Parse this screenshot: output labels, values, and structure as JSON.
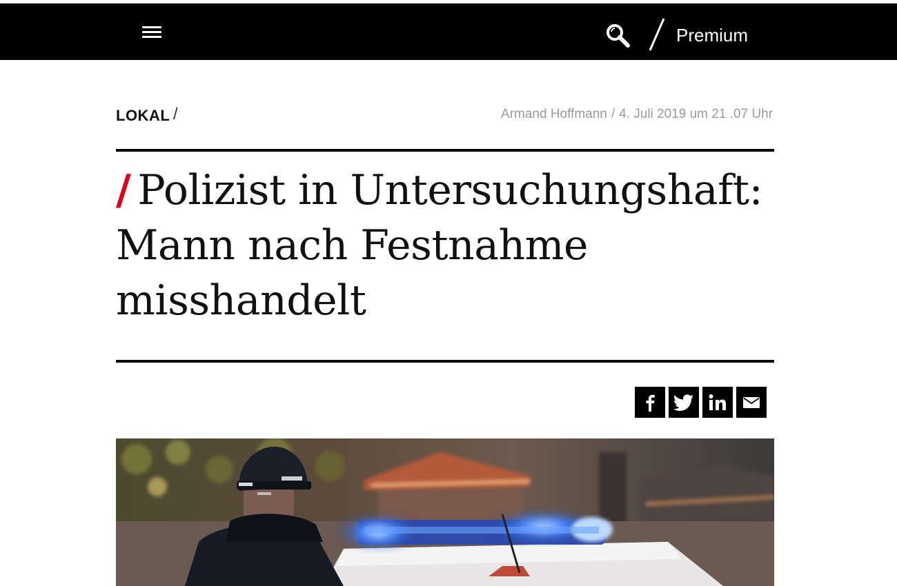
{
  "header": {
    "menu_icon": "hamburger-menu-icon",
    "search_icon": "search-icon",
    "premium_label": "Premium"
  },
  "article": {
    "section": "LOKAL",
    "section_separator": "/",
    "author": "Armand Hoffmann",
    "byline_separator": "/",
    "date": "4. Juli 2019 um 21 .07 Uhr",
    "headline_slash": "/",
    "headline": "Polizist in Untersuchungshaft: Mann nach Festnahme misshandelt",
    "accent_color": "#e2001a"
  },
  "share": {
    "buttons": [
      {
        "icon": "facebook-icon"
      },
      {
        "icon": "twitter-icon"
      },
      {
        "icon": "linkedin-icon"
      },
      {
        "icon": "email-icon"
      }
    ]
  },
  "hero_image": {
    "subject": "police-officer-with-patrol-car-photo"
  }
}
